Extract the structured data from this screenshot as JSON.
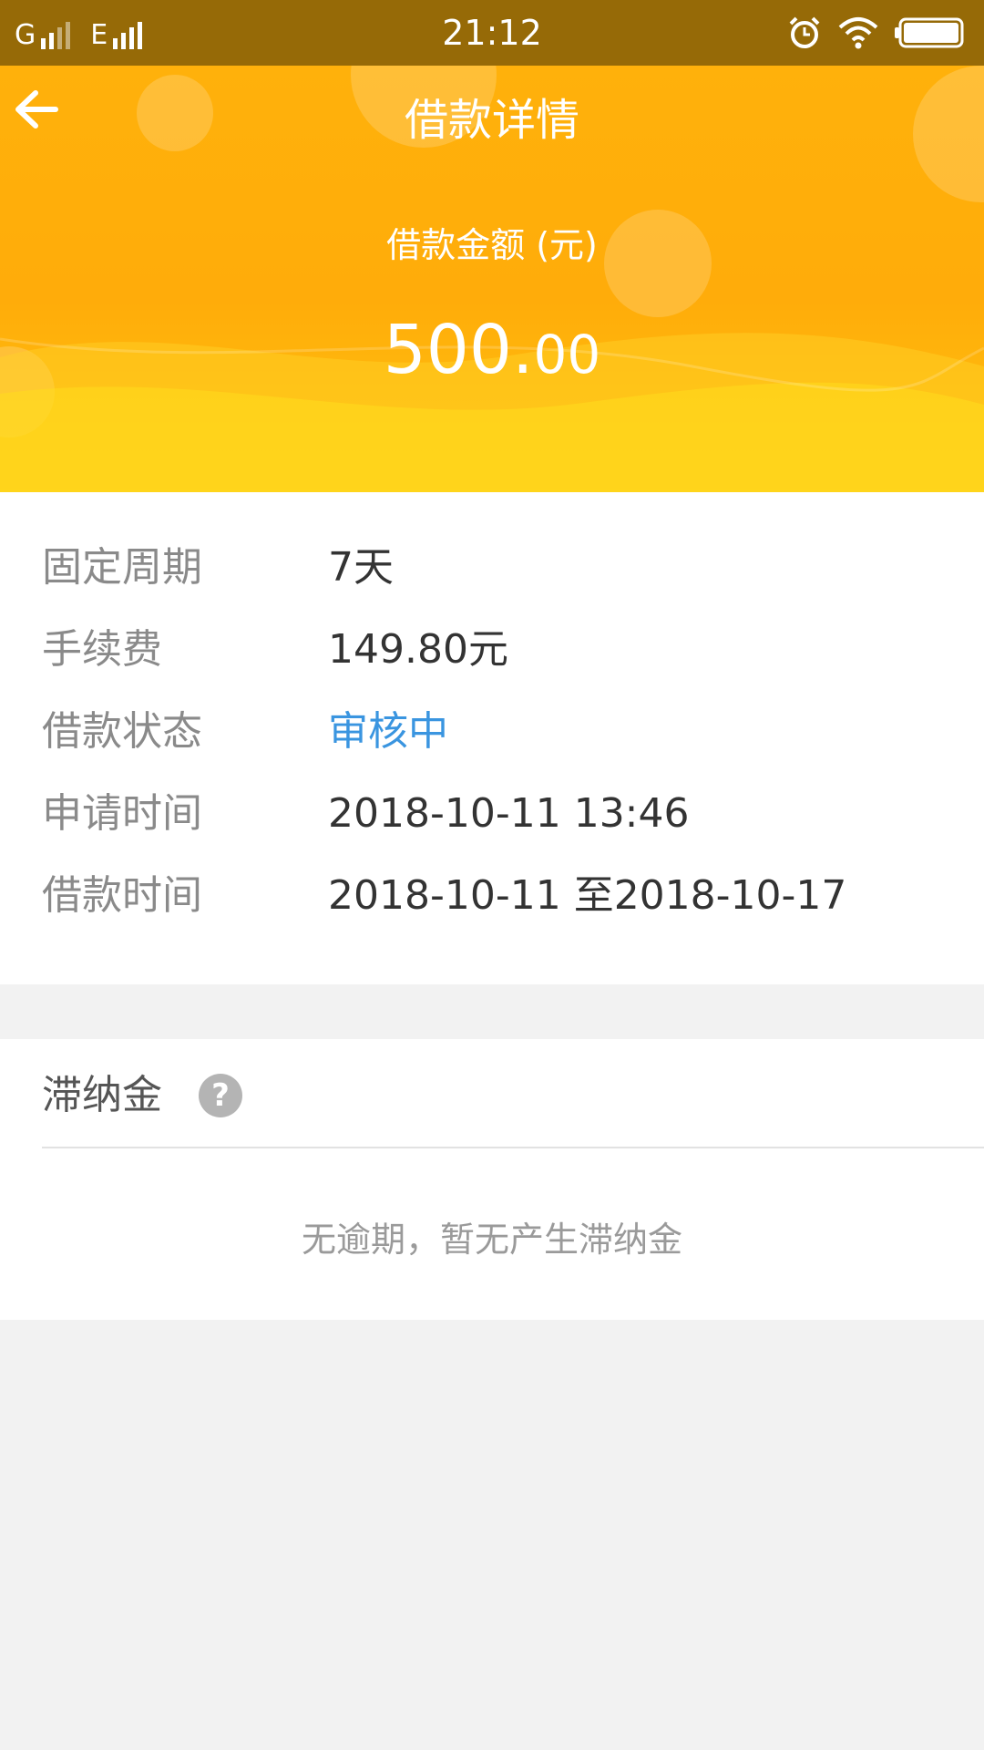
{
  "status_bar": {
    "network_1": "G",
    "network_2": "E",
    "time": "21:12",
    "icons": [
      "alarm-icon",
      "wifi-icon",
      "battery-icon"
    ]
  },
  "header": {
    "back_icon": "arrow-left-icon",
    "title": "借款详情",
    "amount_label": "借款金额 (元)",
    "amount_integer": "500.",
    "amount_decimal": "00"
  },
  "details": {
    "rows": [
      {
        "label": "固定周期",
        "value": "7天"
      },
      {
        "label": "手续费",
        "value": "149.80元"
      },
      {
        "label": "借款状态",
        "value": "审核中"
      },
      {
        "label": "申请时间",
        "value": "2018-10-11 13:46"
      },
      {
        "label": "借款时间",
        "value": "2018-10-11 至2018-10-17"
      }
    ]
  },
  "late_fee": {
    "title": "滞纳金",
    "help_icon": "?",
    "empty_text": "无逾期，暂无产生滞纳金"
  },
  "colors": {
    "status_bar_bg": "#966a07",
    "header_orange": "#ffac0a",
    "header_yellow": "#ffc60f",
    "status_accent": "#3a95e0",
    "page_bg": "#f2f2f2"
  }
}
